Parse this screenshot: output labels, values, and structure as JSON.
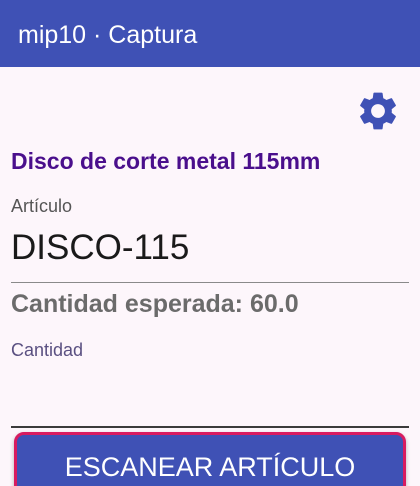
{
  "app_bar": {
    "title": "mip10 · Captura"
  },
  "toolbar": {
    "settings_icon": "gear-icon",
    "settings_color": "#3f51b5"
  },
  "product": {
    "name": "Disco de corte metal 115mm"
  },
  "article": {
    "label": "Artículo",
    "value": "DISCO-115"
  },
  "expected": {
    "text": "Cantidad esperada: 60.0"
  },
  "quantity": {
    "label": "Cantidad",
    "value": ""
  },
  "scan_button": {
    "label": "ESCANEAR ARTÍCULO"
  },
  "colors": {
    "primary": "#3f51b5",
    "accent": "#d81b60",
    "product_name": "#4a0f8c",
    "background": "#fdf6fb"
  }
}
